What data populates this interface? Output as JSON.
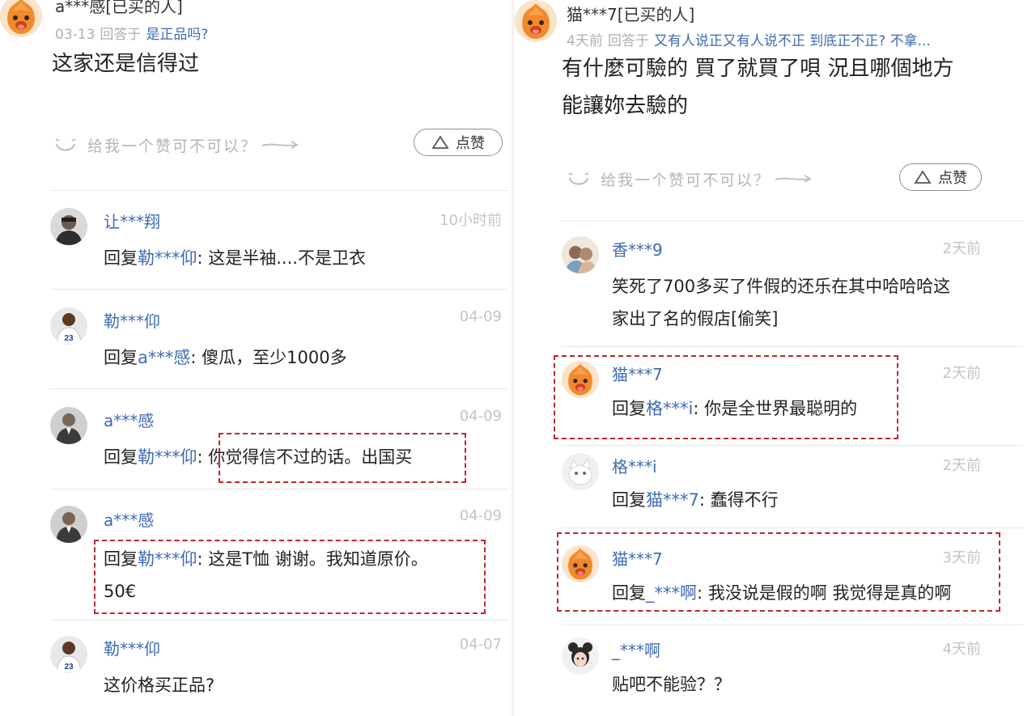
{
  "left": {
    "top": {
      "name": "a***感[已买的人]",
      "date": "03-13",
      "answered_label": "回答于",
      "question": "是正品吗?",
      "answer": "这家还是信得过",
      "like_hint": "给我一个赞可不可以？",
      "like_label": "点赞"
    },
    "comments": [
      {
        "name": "让***翔",
        "time": "10小时前",
        "prefix": "回复",
        "to": "勒***仰",
        "body": ": 这是半袖....不是卫衣"
      },
      {
        "name": "勒***仰",
        "time": "04-09",
        "prefix": "回复",
        "to": "a***感",
        "body": ": 傻瓜，至少1000多"
      },
      {
        "name": "a***感",
        "time": "04-09",
        "prefix": "回复",
        "to": "勒***仰",
        "body": ": 你觉得信不过的话。出国买"
      },
      {
        "name": "a***感",
        "time": "04-09",
        "prefix": "回复",
        "to": "勒***仰",
        "body": ": 这是T恤 谢谢。我知道原价。",
        "body2": "50€"
      },
      {
        "name": "勒***仰",
        "time": "04-07",
        "prefix": "",
        "to": "",
        "body": "这价格买正品?"
      }
    ]
  },
  "right": {
    "top": {
      "name": "猫***7[已买的人]",
      "date": "4天前",
      "answered_label": "回答于",
      "question": "又有人说正又有人说不正 到底正不正? 不拿...",
      "answer_line1": "有什麼可驗的 買了就買了唄 況且哪個地方",
      "answer_line2": "能讓妳去驗的",
      "like_hint": "给我一个赞可不可以？",
      "like_label": "点赞"
    },
    "comments": [
      {
        "name": "香***9",
        "time": "2天前",
        "prefix": "",
        "to": "",
        "body": "笑死了700多买了件假的还乐在其中哈哈哈这",
        "body2": "家出了名的假店[偷笑]"
      },
      {
        "name": "猫***7",
        "time": "2天前",
        "prefix": "回复",
        "to": "格***i",
        "body": ": 你是全世界最聪明的"
      },
      {
        "name": "格***i",
        "time": "2天前",
        "prefix": "回复",
        "to": "猫***7",
        "body": ": 蠢得不行"
      },
      {
        "name": "猫***7",
        "time": "3天前",
        "prefix": "回复",
        "to": "_***啊",
        "body": ": 我没说是假的啊 我觉得是真的啊"
      },
      {
        "name": "_***啊",
        "time": "4天前",
        "prefix": "",
        "to": "",
        "body": "贴吧不能验？？"
      }
    ]
  },
  "colors": {
    "link_blue": "#3f6bb5",
    "highlight_red": "#c0262d",
    "avatar_orange": "#f08a2c",
    "muted_gray": "#b0b0b0"
  },
  "icons": [
    "orange-mascot-avatar",
    "user-photo-avatar",
    "smile-icon",
    "arrow-icon",
    "triangle-like-icon"
  ]
}
